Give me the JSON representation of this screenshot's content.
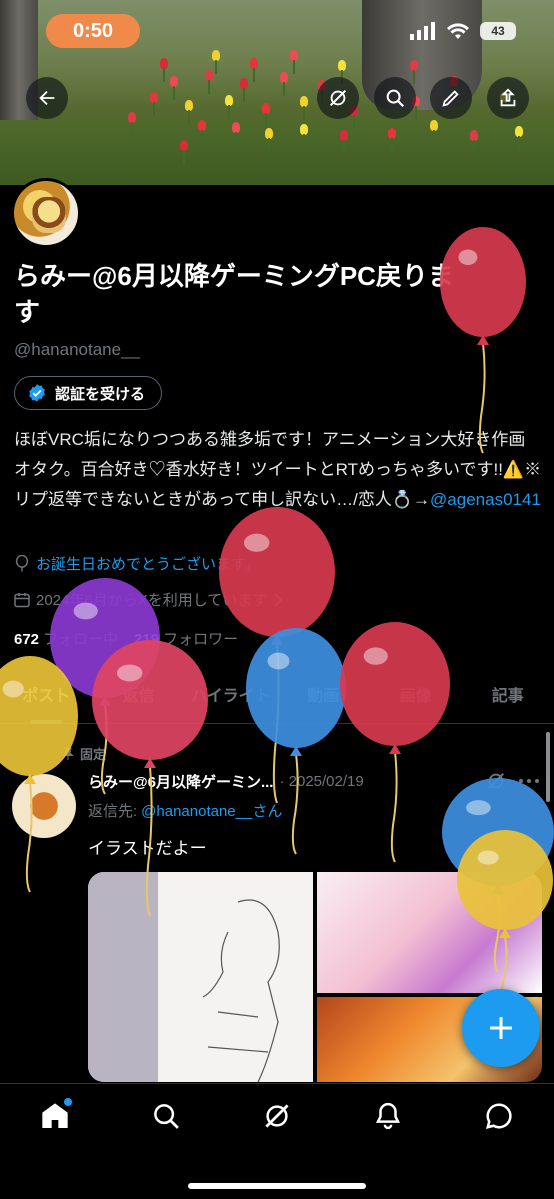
{
  "status_bar": {
    "time": "0:50",
    "battery": "43"
  },
  "header": {
    "back_icon": "back-arrow-icon",
    "actions": [
      "grok-icon",
      "search-icon",
      "edit-icon",
      "share-icon"
    ]
  },
  "profile": {
    "name": "らみー@6月以降ゲーミングPC戻りま\nす",
    "handle": "@hananotane__",
    "verify_button": "認証を受ける",
    "bio_prefix": "ほぼVRC垢になりつつある雑多垢です！アニメーション大好き作画オタク。百合好き♡香水好き！ツイートとRTめっちゃ多いです!!⚠️※リプ返等できないときがあって申し訳ない…/恋人💍→",
    "bio_link": "@agenas0141",
    "birthday": "お誕生日おめでとうございます。",
    "joined": "2024年6月からXを利用しています",
    "following_count": "672",
    "following_label": "フォロー中",
    "followers_count": "219",
    "followers_label": "フォロワー"
  },
  "tabs": [
    "ポスト",
    "返信",
    "ハイライト",
    "動画",
    "画像",
    "記事"
  ],
  "active_tab": 0,
  "post": {
    "pinned_label": "固定",
    "author": "らみー@6月以降ゲーミン...",
    "date": "· 2025/02/19",
    "reply_prefix": "返信先:",
    "reply_handle": "@hananotane__さん",
    "text": "イラストだよー"
  },
  "fab_icon": "plus-icon",
  "bottom_nav": [
    "home-icon",
    "search-icon",
    "grok-icon",
    "notifications-icon",
    "messages-icon"
  ],
  "colors": {
    "accent": "#1d9bf0",
    "background": "#000000",
    "text": "#e7e9ea",
    "muted": "#71767b"
  }
}
